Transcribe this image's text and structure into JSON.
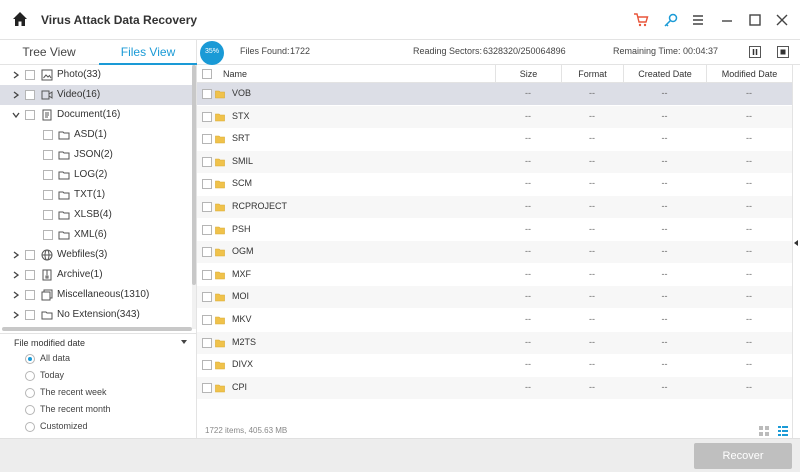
{
  "app": {
    "title": "Virus Attack Data Recovery"
  },
  "titlebar": {
    "icons": [
      "cart-icon",
      "key-icon",
      "menu-icon",
      "minimize-icon",
      "maximize-icon",
      "close-icon"
    ]
  },
  "left_tabs": [
    {
      "label": "Tree View"
    },
    {
      "label": "Files View",
      "active": true
    }
  ],
  "tree": [
    {
      "label": "Photo(33)",
      "expandable": true,
      "icon": "photo-icon"
    },
    {
      "label": "Video(16)",
      "expandable": true,
      "icon": "video-icon",
      "selected": true
    },
    {
      "label": "Document(16)",
      "expandable": true,
      "expanded": true,
      "icon": "document-icon"
    },
    {
      "label": "ASD(1)",
      "indent": true,
      "icon": "folder-icon"
    },
    {
      "label": "JSON(2)",
      "indent": true,
      "icon": "folder-icon"
    },
    {
      "label": "LOG(2)",
      "indent": true,
      "icon": "folder-icon"
    },
    {
      "label": "TXT(1)",
      "indent": true,
      "icon": "folder-icon"
    },
    {
      "label": "XLSB(4)",
      "indent": true,
      "icon": "folder-icon"
    },
    {
      "label": "XML(6)",
      "indent": true,
      "icon": "folder-icon"
    },
    {
      "label": "Webfiles(3)",
      "expandable": true,
      "icon": "globe-icon"
    },
    {
      "label": "Archive(1)",
      "expandable": true,
      "icon": "archive-icon"
    },
    {
      "label": "Miscellaneous(1310)",
      "expandable": true,
      "icon": "misc-icon"
    },
    {
      "label": "No Extension(343)",
      "expandable": true,
      "icon": "folder-icon"
    }
  ],
  "filter": {
    "label": "File modified date",
    "options": [
      {
        "label": "All data",
        "selected": true
      },
      {
        "label": "Today"
      },
      {
        "label": "The recent week"
      },
      {
        "label": "The recent month"
      },
      {
        "label": "Customized"
      }
    ]
  },
  "status": {
    "spinner_text": "35%",
    "files_found_label": "Files Found:",
    "files_found_value": "1722",
    "reading_label": "Reading Sectors:",
    "reading_value": "6328320/250064896",
    "remaining_label": "Remaining Time:",
    "remaining_value": "00:04:37"
  },
  "table": {
    "columns": [
      "Name",
      "Size",
      "Format",
      "Created Date",
      "Modified Date"
    ],
    "rows": [
      {
        "name": "VOB",
        "size": "--",
        "format": "--",
        "created": "--",
        "modified": "--",
        "selected": true
      },
      {
        "name": "STX",
        "size": "--",
        "format": "--",
        "created": "--",
        "modified": "--"
      },
      {
        "name": "SRT",
        "size": "--",
        "format": "--",
        "created": "--",
        "modified": "--"
      },
      {
        "name": "SMIL",
        "size": "--",
        "format": "--",
        "created": "--",
        "modified": "--"
      },
      {
        "name": "SCM",
        "size": "--",
        "format": "--",
        "created": "--",
        "modified": "--"
      },
      {
        "name": "RCPROJECT",
        "size": "--",
        "format": "--",
        "created": "--",
        "modified": "--"
      },
      {
        "name": "PSH",
        "size": "--",
        "format": "--",
        "created": "--",
        "modified": "--"
      },
      {
        "name": "OGM",
        "size": "--",
        "format": "--",
        "created": "--",
        "modified": "--"
      },
      {
        "name": "MXF",
        "size": "--",
        "format": "--",
        "created": "--",
        "modified": "--"
      },
      {
        "name": "MOI",
        "size": "--",
        "format": "--",
        "created": "--",
        "modified": "--"
      },
      {
        "name": "MKV",
        "size": "--",
        "format": "--",
        "created": "--",
        "modified": "--"
      },
      {
        "name": "M2TS",
        "size": "--",
        "format": "--",
        "created": "--",
        "modified": "--"
      },
      {
        "name": "DIVX",
        "size": "--",
        "format": "--",
        "created": "--",
        "modified": "--"
      },
      {
        "name": "CPI",
        "size": "--",
        "format": "--",
        "created": "--",
        "modified": "--"
      }
    ]
  },
  "footer": {
    "count": "1722 items, 405.63 MB"
  },
  "actions": {
    "recover_label": "Recover"
  },
  "colors": {
    "accent": "#1a9ad6",
    "selected_row": "#dcdee6",
    "folder": "#f0c24b",
    "cart": "#e8553a",
    "button_disabled": "#bfbfbf"
  }
}
